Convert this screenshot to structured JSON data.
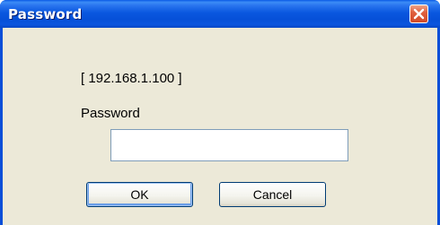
{
  "window": {
    "title": "Password",
    "close_icon": "close-x-icon"
  },
  "dialog": {
    "address_text": "[ 192.168.1.100 ]",
    "password_label": "Password",
    "password_value": "",
    "ok_label": "OK",
    "cancel_label": "Cancel"
  },
  "colors": {
    "titlebar": "#0a58e0",
    "close_button": "#e0603e",
    "client_background": "#ece9d8",
    "input_border": "#7f9db9",
    "button_border": "#003c74"
  }
}
